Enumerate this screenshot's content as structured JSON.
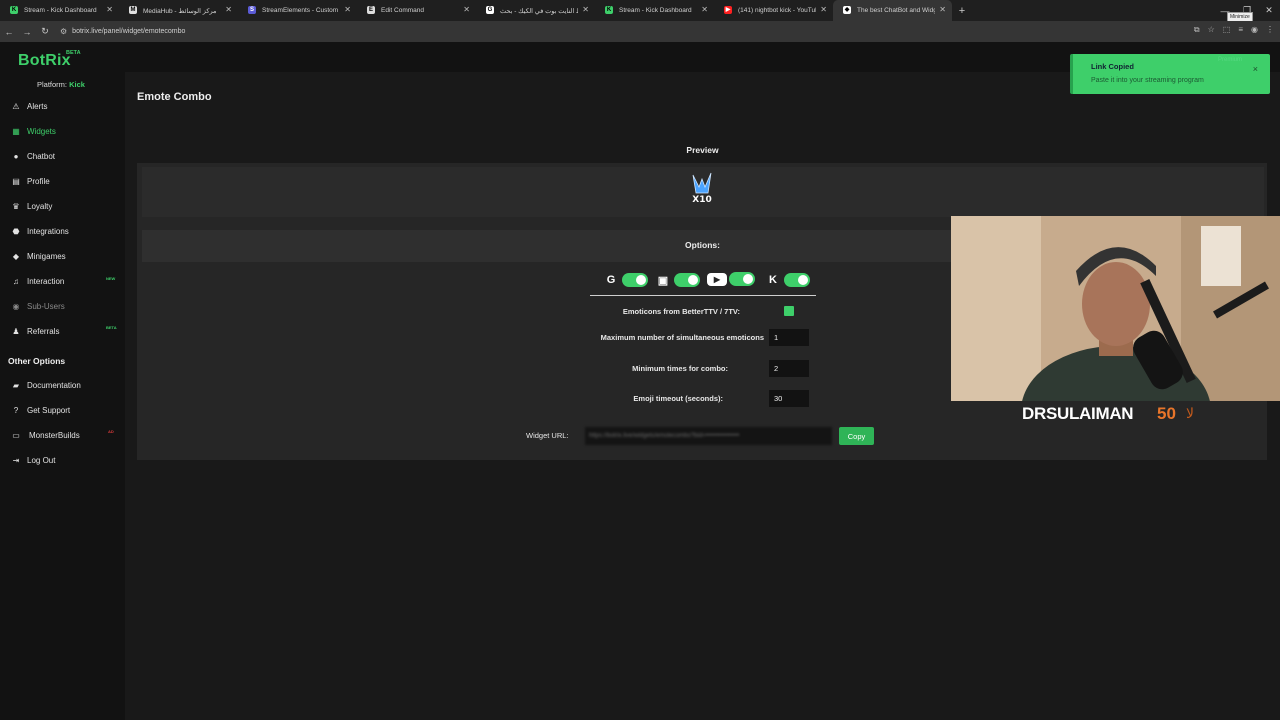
{
  "browser": {
    "tabs": [
      {
        "title": "Stream - Kick Dashboard",
        "fav_color": "#3ecf6a",
        "fav_glyph": "K"
      },
      {
        "title": "MediaHub - مركز الوسائط",
        "fav_color": "#e0e0e0",
        "fav_glyph": "M"
      },
      {
        "title": "StreamElements - Custom comm",
        "fav_color": "#5b5bd6",
        "fav_glyph": "S"
      },
      {
        "title": "Edit Command",
        "fav_color": "#dddddd",
        "fav_glyph": "E"
      },
      {
        "title": "ربط النايت بوت في الكيك - بحث",
        "fav_color": "#ffffff",
        "fav_glyph": "G"
      },
      {
        "title": "Stream - Kick Dashboard",
        "fav_color": "#3ecf6a",
        "fav_glyph": "K"
      },
      {
        "title": "(141) nightbot kick - YouTube",
        "fav_color": "#ff2020",
        "fav_glyph": "▶"
      },
      {
        "title": "The best ChatBot and Widgets",
        "fav_color": "#ffffff",
        "fav_glyph": "◆"
      }
    ],
    "new_tab": "+",
    "url": "botrix.live/panel/widget/emotecombo",
    "minimize_tooltip": "Minimize"
  },
  "app": {
    "logo": "BotRix",
    "logo_badge": "BETA",
    "platform_label": "Platform:",
    "platform_value": "Kick",
    "accent": "#3ecf6a",
    "nav": [
      {
        "label": "Alerts",
        "icon": "⚠"
      },
      {
        "label": "Widgets",
        "icon": "▦"
      },
      {
        "label": "Chatbot",
        "icon": "●"
      },
      {
        "label": "Profile",
        "icon": "▤"
      },
      {
        "label": "Loyalty",
        "icon": "♛"
      },
      {
        "label": "Integrations",
        "icon": "⬣"
      },
      {
        "label": "Minigames",
        "icon": "◆"
      },
      {
        "label": "Interaction",
        "icon": "♫",
        "badge": "NEW"
      },
      {
        "label": "Sub-Users",
        "icon": "◉"
      },
      {
        "label": "Referrals",
        "icon": "♟",
        "badge": "BETA"
      }
    ],
    "other_heading": "Other Options",
    "other_nav": [
      {
        "label": "Documentation",
        "icon": "▰"
      },
      {
        "label": "Get Support",
        "icon": "?"
      },
      {
        "label": "MonsterBuilds",
        "icon": "▭",
        "badge": "AD"
      },
      {
        "label": "Log Out",
        "icon": "⇥"
      }
    ]
  },
  "page": {
    "title": "Emote Combo",
    "preview_label": "Preview",
    "preview_multiplier": "X10",
    "options_label": "Options:",
    "platforms": [
      {
        "icon": "kick-bot",
        "glyph": "G"
      },
      {
        "icon": "twitch",
        "glyph": "▣"
      },
      {
        "icon": "youtube",
        "glyph": "▶"
      },
      {
        "icon": "kick",
        "glyph": "K"
      }
    ],
    "options": [
      {
        "label": "Emoticons from BetterTTV / 7TV:",
        "type": "checkbox"
      },
      {
        "label": "Maximum number of simultaneous emoticons",
        "value": "1"
      },
      {
        "label": "Minimum times for combo:",
        "value": "2"
      },
      {
        "label": "Emoji timeout (seconds):",
        "value": "30"
      }
    ],
    "widget_url_label": "Widget URL:",
    "widget_url_value": "https://botrix.live/widgets/emotecombo?bid=••••••••••••••••",
    "copy_button": "Copy"
  },
  "toast": {
    "title": "Link Copied",
    "message": "Paste it into your streaming program",
    "ghost": "Premium",
    "close": "×"
  },
  "webcam": {
    "name": "DRSULAIMAN",
    "number": "50",
    "symbol": "ﻻ"
  }
}
